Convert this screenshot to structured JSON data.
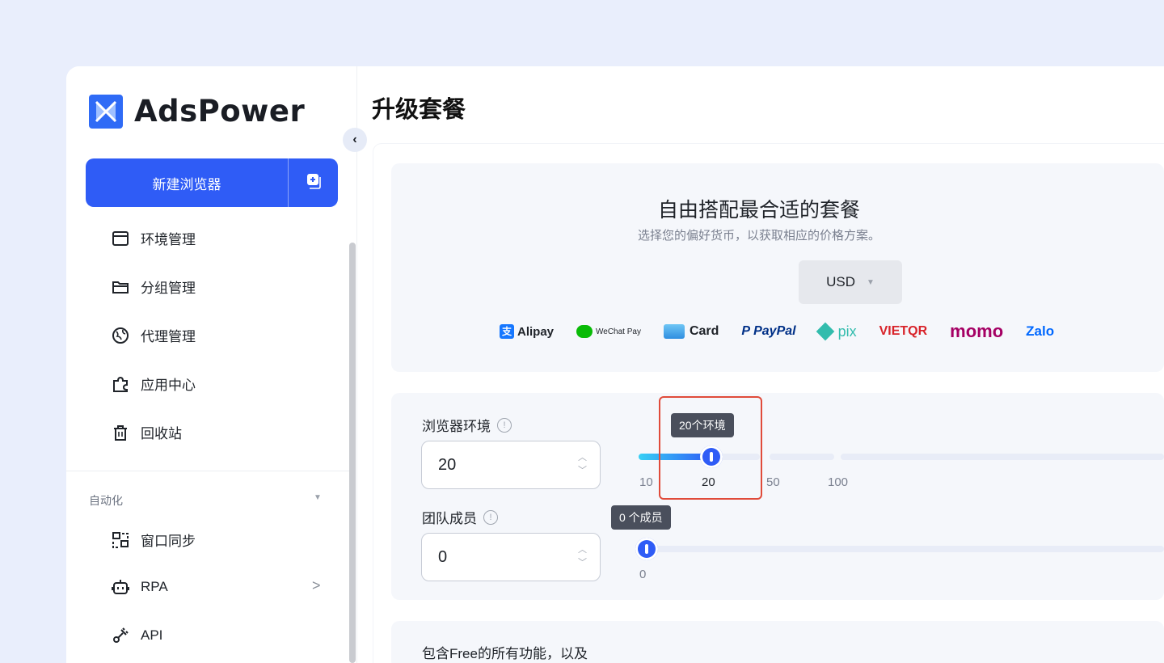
{
  "brand": {
    "name": "AdsPower"
  },
  "sidebar": {
    "new_browser_label": "新建浏览器",
    "items": [
      {
        "label": "环境管理",
        "icon": "window-icon"
      },
      {
        "label": "分组管理",
        "icon": "folder-icon"
      },
      {
        "label": "代理管理",
        "icon": "globe-icon"
      },
      {
        "label": "应用中心",
        "icon": "puzzle-icon"
      },
      {
        "label": "回收站",
        "icon": "trash-icon"
      }
    ],
    "automation_section": "自动化",
    "automation_items": [
      {
        "label": "窗口同步",
        "icon": "sync-windows-icon"
      },
      {
        "label": "RPA",
        "icon": "robot-icon"
      },
      {
        "label": "API",
        "icon": "plug-icon"
      }
    ]
  },
  "page": {
    "title": "升级套餐"
  },
  "plan": {
    "heading": "自由搭配最合适的套餐",
    "subheading": "选择您的偏好货币，以获取相应的价格方案。",
    "currency": "USD",
    "payments": [
      "Alipay",
      "WeChat Pay",
      "Card",
      "PayPal",
      "pix",
      "VIETQR",
      "momo",
      "Zalo"
    ]
  },
  "config": {
    "browsers_label": "浏览器环境",
    "browsers_value": "20",
    "browsers_tooltip": "20个环境",
    "browsers_ticks": [
      "10",
      "20",
      "50",
      "100"
    ],
    "members_label": "团队成员",
    "members_value": "0",
    "members_tooltip": "0 个成员",
    "members_ticks": [
      "0"
    ]
  },
  "features": {
    "title": "包含Free的所有功能，以及"
  },
  "colors": {
    "accent": "#2f5cf6",
    "highlight": "#e04b3a"
  }
}
